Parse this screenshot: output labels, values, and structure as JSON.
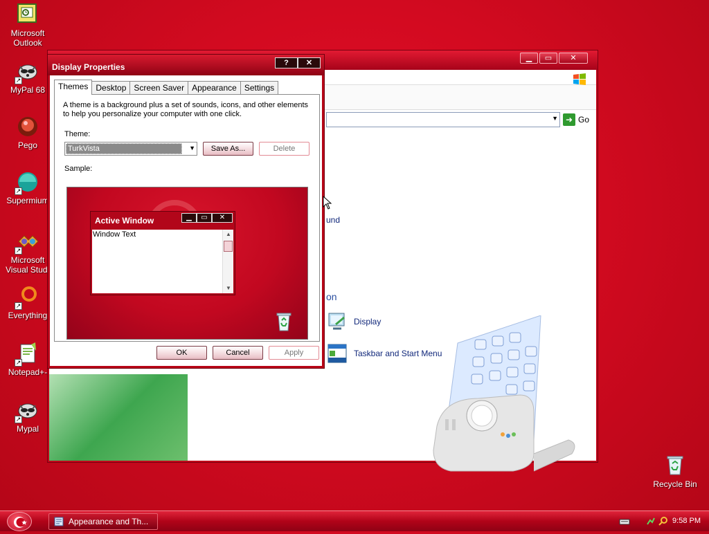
{
  "desktop": {
    "icons": [
      {
        "label_line1": "Microsoft",
        "label_line2": "Outlook",
        "icon": "outlook-icon"
      },
      {
        "label_line1": "MyPal 68",
        "label_line2": "",
        "icon": "mypal-icon"
      },
      {
        "label_line1": "Pego",
        "label_line2": "",
        "icon": "pego-icon"
      },
      {
        "label_line1": "Supermium",
        "label_line2": "",
        "icon": "supermium-icon"
      },
      {
        "label_line1": "Microsoft",
        "label_line2": "Visual Stud.",
        "icon": "visual-studio-icon"
      },
      {
        "label_line1": "Everything",
        "label_line2": "",
        "icon": "everything-icon"
      },
      {
        "label_line1": "Notepad+-",
        "label_line2": "",
        "icon": "notepad-icon"
      },
      {
        "label_line1": "Mypal",
        "label_line2": "",
        "icon": "mypal-icon"
      },
      {
        "label_line1": "Recycle Bin",
        "label_line2": "",
        "icon": "recycle-bin-icon"
      }
    ]
  },
  "control_panel": {
    "go_label": "Go",
    "partial_items": {
      "sound": "und",
      "section": "on"
    },
    "items": [
      {
        "label": "Display",
        "icon": "display-icon"
      },
      {
        "label": "Taskbar and Start Menu",
        "icon": "taskbar-icon"
      }
    ]
  },
  "dialog": {
    "title": "Display Properties",
    "help_btn": "?",
    "close_btn": "✕",
    "tabs": [
      "Themes",
      "Desktop",
      "Screen Saver",
      "Appearance",
      "Settings"
    ],
    "active_tab": "Themes",
    "description": "A theme is a background plus a set of sounds, icons, and other elements to help you personalize your computer with one click.",
    "theme_label": "Theme:",
    "theme_value": "TurkVista",
    "save_as": "Save As...",
    "delete": "Delete",
    "sample_label": "Sample:",
    "sample": {
      "window_title": "Active Window",
      "window_text": "Window Text"
    },
    "ok": "OK",
    "cancel": "Cancel",
    "apply": "Apply"
  },
  "taskbar": {
    "task_label": "Appearance and Th...",
    "clock": "9:58 PM"
  },
  "colors": {
    "desktop": "#d30a20",
    "title_bar": "#b80418",
    "link": "#10277a"
  }
}
